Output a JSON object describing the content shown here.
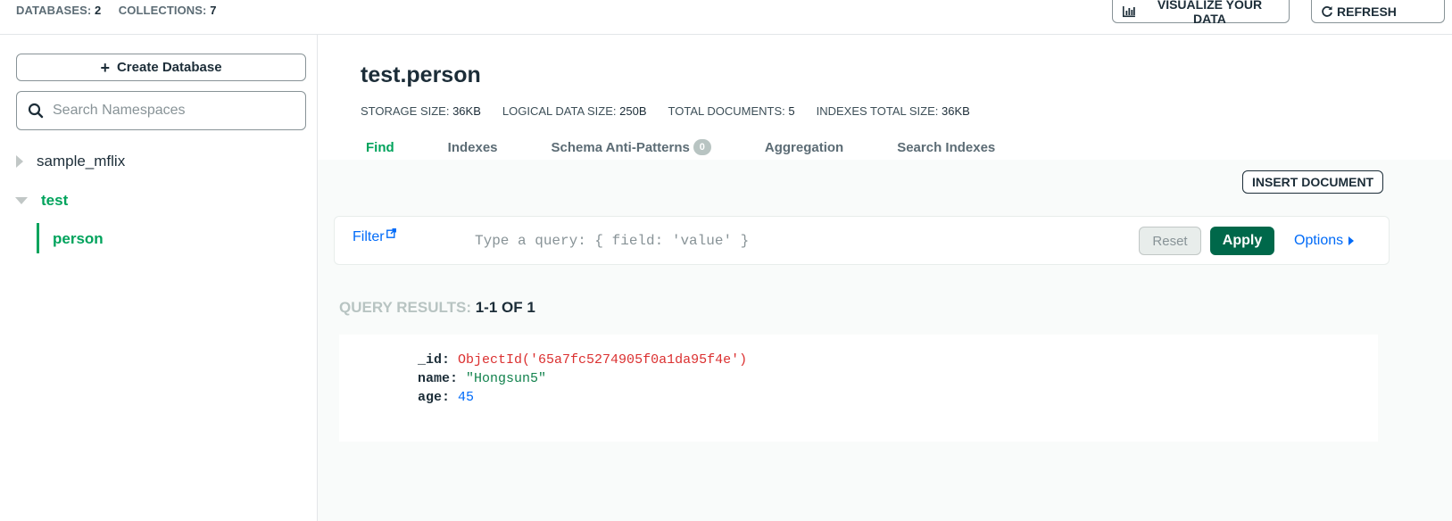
{
  "header": {
    "databases_label": "DATABASES:",
    "databases_count": "2",
    "collections_label": "COLLECTIONS:",
    "collections_count": "7",
    "visualize_label": "VISUALIZE YOUR DATA",
    "refresh_label": "REFRESH"
  },
  "sidebar": {
    "create_db_label": "Create Database",
    "search_placeholder": "Search Namespaces",
    "databases": [
      {
        "name": "sample_mflix",
        "expanded": false
      },
      {
        "name": "test",
        "expanded": true,
        "collections": [
          {
            "name": "person",
            "active": true
          }
        ]
      }
    ]
  },
  "collection": {
    "title": "test.person",
    "stats": {
      "storage_label": "STORAGE SIZE:",
      "storage_value": "36KB",
      "logical_label": "LOGICAL DATA SIZE:",
      "logical_value": "250B",
      "docs_label": "TOTAL DOCUMENTS:",
      "docs_value": "5",
      "indexes_label": "INDEXES TOTAL SIZE:",
      "indexes_value": "36KB"
    },
    "tabs": [
      {
        "label": "Find",
        "active": true
      },
      {
        "label": "Indexes"
      },
      {
        "label": "Schema Anti-Patterns",
        "badge": "0"
      },
      {
        "label": "Aggregation"
      },
      {
        "label": "Search Indexes"
      }
    ]
  },
  "query": {
    "insert_label": "INSERT DOCUMENT",
    "filter_label": "Filter",
    "placeholder": "Type a query: { field: 'value' }",
    "reset_label": "Reset",
    "apply_label": "Apply",
    "options_label": "Options"
  },
  "results": {
    "label": "QUERY RESULTS:",
    "range": "1-1 OF 1",
    "document": {
      "id_key": "_id:",
      "id_value": "ObjectId('65a7fc5274905f0a1da95f4e')",
      "name_key": "name:",
      "name_value": "\"Hongsun5\"",
      "age_key": "age:",
      "age_value": "45"
    }
  },
  "colors": {
    "accent_green": "#00a35c",
    "apply_green": "#00684a",
    "link_blue": "#016bf8",
    "objectid_red": "#db3030"
  }
}
